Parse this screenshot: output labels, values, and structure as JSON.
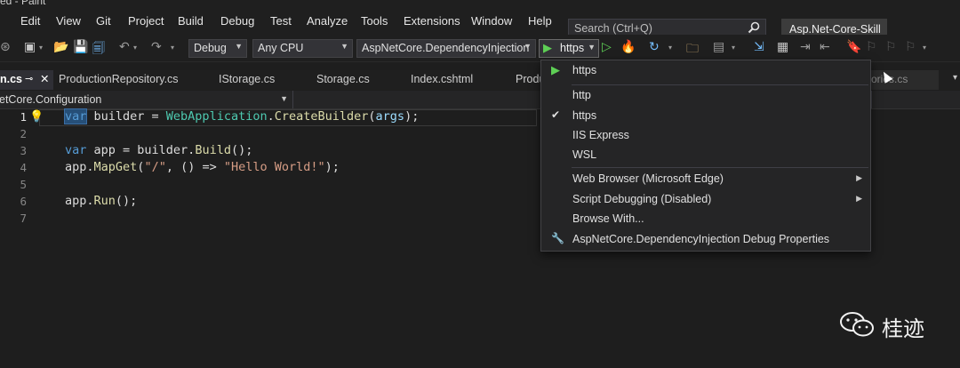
{
  "titlebar": {
    "text": "ed - Paint"
  },
  "menu": [
    "Edit",
    "View",
    "Git",
    "Project",
    "Build",
    "Debug",
    "Test",
    "Analyze",
    "Tools",
    "Extensions",
    "Window",
    "Help"
  ],
  "search": {
    "placeholder": "Search (Ctrl+Q)"
  },
  "solution_name": "Asp.Net-Core-Skill",
  "toolbar": {
    "config": "Debug",
    "platform": "Any CPU",
    "startup_project": "AspNetCore.DependencyInjection",
    "run_profile": "https"
  },
  "tabs": [
    {
      "label": "n.cs",
      "active": true
    },
    {
      "label": "ProductionRepository.cs"
    },
    {
      "label": "IStorage.cs"
    },
    {
      "label": "Storage.cs"
    },
    {
      "label": "Index.cshtml"
    },
    {
      "label": "Produ"
    }
  ],
  "hidden_tab_label": "ories.cs",
  "navigation": {
    "scope": "etCore.Configuration"
  },
  "code_lines": [
    {
      "no": "1",
      "text": "var builder = WebApplication.CreateBuilder(args);"
    },
    {
      "no": "2",
      "text": ""
    },
    {
      "no": "3",
      "text": "var app = builder.Build();"
    },
    {
      "no": "4",
      "text": "app.MapGet(\"/\", () => \"Hello World!\");"
    },
    {
      "no": "5",
      "text": ""
    },
    {
      "no": "6",
      "text": "app.Run();"
    },
    {
      "no": "7",
      "text": ""
    }
  ],
  "code_tokens": {
    "l1_var": "var",
    "l1_builder": " builder = ",
    "l1_type": "WebApplication",
    "l1_dot": ".",
    "l1_meth": "CreateBuilder",
    "l1_rest": "(",
    "l1_args": "args",
    "l1_end": ");",
    "l3_var": "var",
    "l3_rest": " app = builder.",
    "l3_meth": "Build",
    "l3_end": "();",
    "l4_a": "app.",
    "l4_meth": "MapGet",
    "l4_b": "(",
    "l4_s1": "\"/\"",
    "l4_c": ", () => ",
    "l4_s2": "\"Hello World!\"",
    "l4_d": ");",
    "l6_a": "app.",
    "l6_meth": "Run",
    "l6_b": "();"
  },
  "run_dropdown": {
    "header": "https",
    "profiles": [
      {
        "label": "http",
        "checked": false
      },
      {
        "label": "https",
        "checked": true
      },
      {
        "label": "IIS Express",
        "checked": false
      },
      {
        "label": "WSL",
        "checked": false
      }
    ],
    "web_browser": "Web Browser (Microsoft Edge)",
    "script_debugging": "Script Debugging (Disabled)",
    "browse_with": "Browse With...",
    "debug_properties": "AspNetCore.DependencyInjection Debug Properties"
  },
  "watermark": {
    "text": "桂迹"
  },
  "colors": {
    "run_green": "#5ecf55",
    "keyword": "#569cd6",
    "type": "#4ec9b0",
    "method": "#dcdcaa",
    "string": "#d69d85"
  }
}
